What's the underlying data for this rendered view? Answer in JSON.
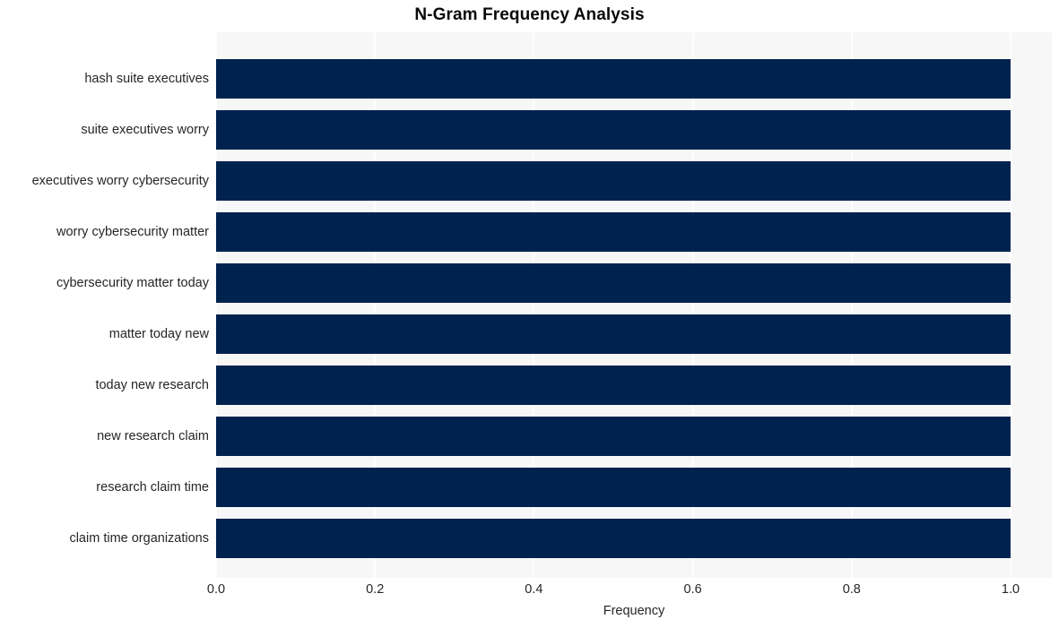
{
  "chart_data": {
    "type": "bar",
    "orientation": "horizontal",
    "title": "N-Gram Frequency Analysis",
    "xlabel": "Frequency",
    "ylabel": "",
    "xlim": [
      0.0,
      1.0
    ],
    "xticks": [
      "0.0",
      "0.2",
      "0.4",
      "0.6",
      "0.8",
      "1.0"
    ],
    "xtick_values": [
      0.0,
      0.2,
      0.4,
      0.6,
      0.8,
      1.0
    ],
    "grid": "vertical-white-on-gray",
    "legend": "none",
    "bar_color": "#00224e",
    "plot_bg": "#f7f7f7",
    "figure_bg": "#ffffff",
    "categories": [
      "hash suite executives",
      "suite executives worry",
      "executives worry cybersecurity",
      "worry cybersecurity matter",
      "cybersecurity matter today",
      "matter today new",
      "today new research",
      "new research claim",
      "research claim time",
      "claim time organizations"
    ],
    "values": [
      1.0,
      1.0,
      1.0,
      1.0,
      1.0,
      1.0,
      1.0,
      1.0,
      1.0,
      1.0
    ]
  }
}
